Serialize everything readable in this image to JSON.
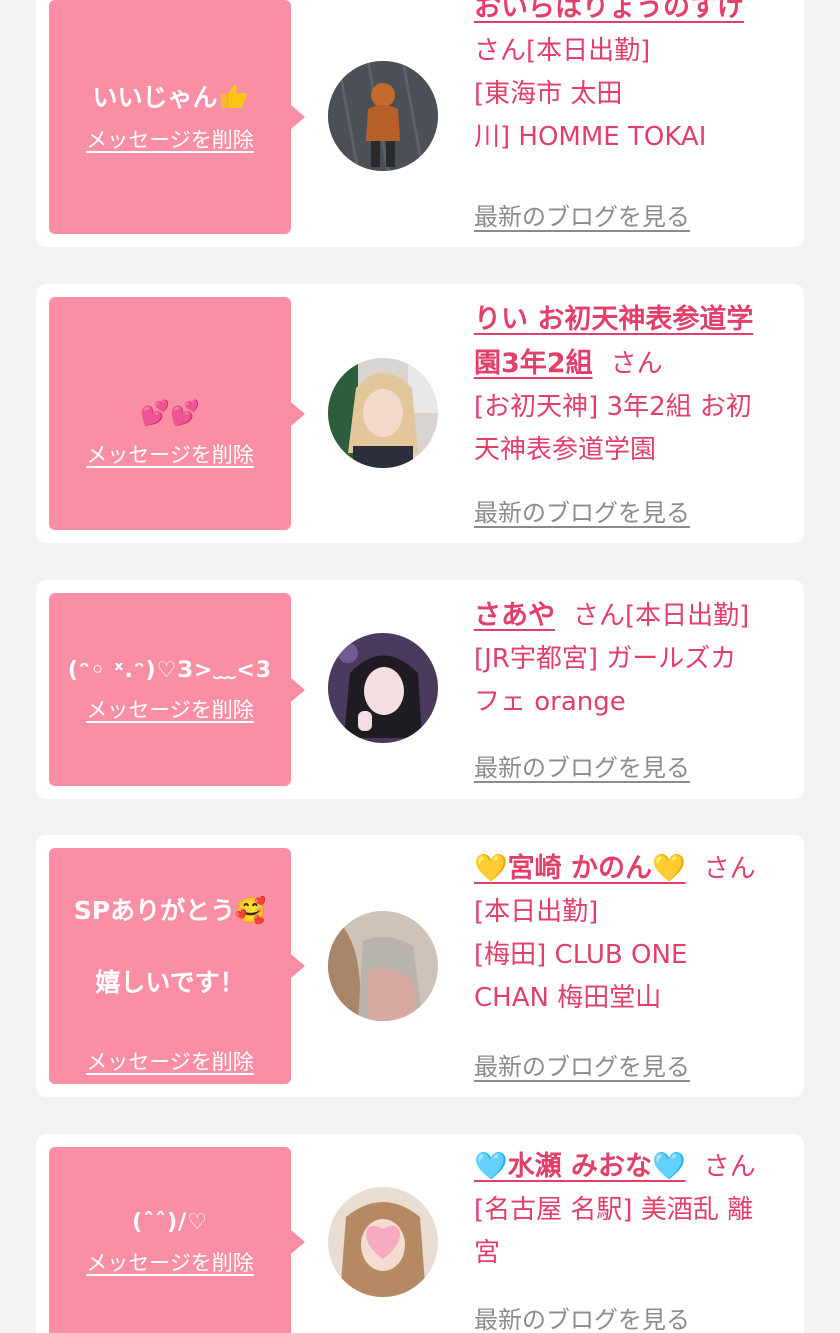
{
  "cards": [
    {
      "message": "いいじゃん",
      "delete_label": "メッセージを削除",
      "name": "おいらはりょうのすけ",
      "honorific": "さん[本日出勤]",
      "shop_line1": "[東海市 太田",
      "shop_line2": "川] HOMME TOKAI",
      "blog_label": "最新のブログを見る"
    },
    {
      "message": "",
      "delete_label": "メッセージを削除",
      "name_line1": "りい お初天神表参道学",
      "name_line2": "園3年2組",
      "honorific": "さん",
      "shop_line1": "[お初天神] 3年2組 お初",
      "shop_line2": "天神表参道学園",
      "blog_label": "最新のブログを見る"
    },
    {
      "message": "(ᵔ◦ ˣ.ᵔ)♡З>﹏<3",
      "delete_label": "メッセージを削除",
      "name": "さあや",
      "honorific": "さん[本日出勤]",
      "shop_line1": "[JR宇都宮] ガールズカ",
      "shop_line2": "フェ orange",
      "blog_label": "最新のブログを見る"
    },
    {
      "message_line1": "SPありがとう",
      "message_line2": "嬉しいです！",
      "delete_label": "メッセージを削除",
      "name": "宮崎 かのん",
      "honorific": "さん",
      "status": "[本日出勤]",
      "shop_line1": "[梅田] CLUB ONE",
      "shop_line2": "CHAN 梅田堂山",
      "blog_label": "最新のブログを見る"
    },
    {
      "message": "(ˆˆ)/♡",
      "delete_label": "メッセージを削除",
      "name": "水瀬 みおな",
      "honorific": "さん",
      "shop_line1": "[名古屋 名駅] 美酒乱 離",
      "shop_line2": "宮",
      "blog_label": "最新のブログを見る"
    }
  ],
  "colors": {
    "accent": "#e23f6a",
    "bubble": "#fa8ea4",
    "muted": "#8c8c8c",
    "background": "#f2f2f2"
  }
}
